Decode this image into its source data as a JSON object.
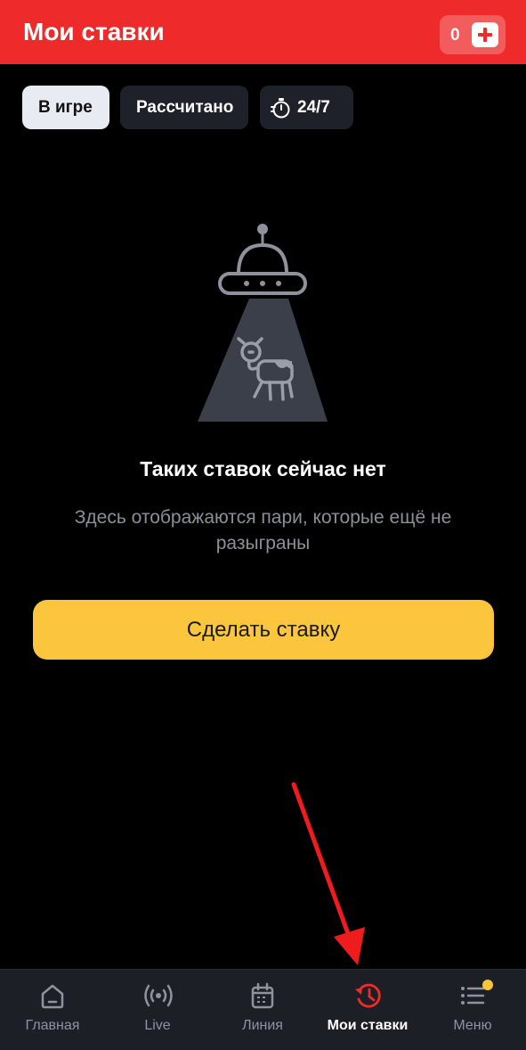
{
  "header": {
    "title": "Мои ставки",
    "balance": "0"
  },
  "tabs": [
    {
      "label": "В игре",
      "active": true
    },
    {
      "label": "Рассчитано",
      "active": false
    },
    {
      "label": "24/7",
      "active": false,
      "icon": "stopwatch-icon"
    }
  ],
  "empty_state": {
    "illustration": "ufo-abducting-cow",
    "title": "Таких ставок сейчас нет",
    "description": "Здесь отображаются пари, которые ещё не разыграны"
  },
  "cta": {
    "label": "Сделать ставку"
  },
  "bottom_nav": [
    {
      "label": "Главная",
      "icon": "home-icon",
      "active": false
    },
    {
      "label": "Live",
      "icon": "broadcast-icon",
      "active": false
    },
    {
      "label": "Линия",
      "icon": "calendar-icon",
      "active": false
    },
    {
      "label": "Мои ставки",
      "icon": "history-icon",
      "active": true
    },
    {
      "label": "Меню",
      "icon": "menu-icon",
      "active": false,
      "badge": true
    }
  ],
  "colors": {
    "brand_red": "#ee2a2a",
    "cta_yellow": "#fcc53e",
    "background": "#000000",
    "nav_background": "#1c1f26",
    "badge_yellow": "#f7c53c"
  }
}
